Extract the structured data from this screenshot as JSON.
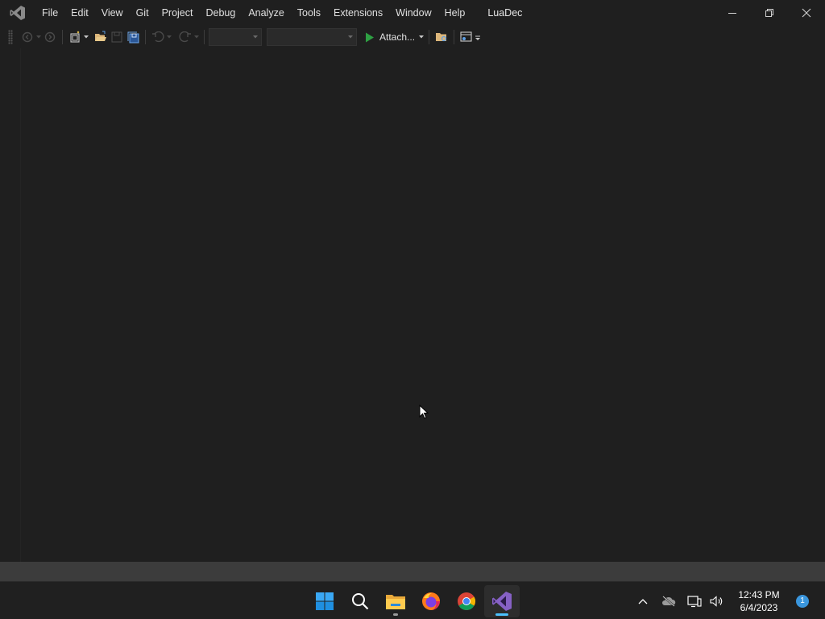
{
  "window": {
    "menu": [
      "File",
      "Edit",
      "View",
      "Git",
      "Project",
      "Debug",
      "Analyze",
      "Tools",
      "Extensions",
      "Window",
      "Help"
    ],
    "solution_name": "LuaDec"
  },
  "toolbar": {
    "attach_label": "Attach..."
  },
  "taskbar": {
    "apps": [
      "start-icon",
      "search-icon",
      "file-explorer-icon",
      "firefox-icon",
      "chrome-icon",
      "visual-studio-icon"
    ],
    "active_app": "visual-studio-icon",
    "clock_time": "12:43 PM",
    "clock_date": "6/4/2023",
    "notification_count": "1"
  },
  "colors": {
    "background": "#1f1f1f",
    "status_bar": "#3c3c3c",
    "taskbar": "#202020",
    "vs_purple": "#8661c5",
    "play_green": "#2ea043",
    "accent_blue": "#4cc2ff"
  }
}
